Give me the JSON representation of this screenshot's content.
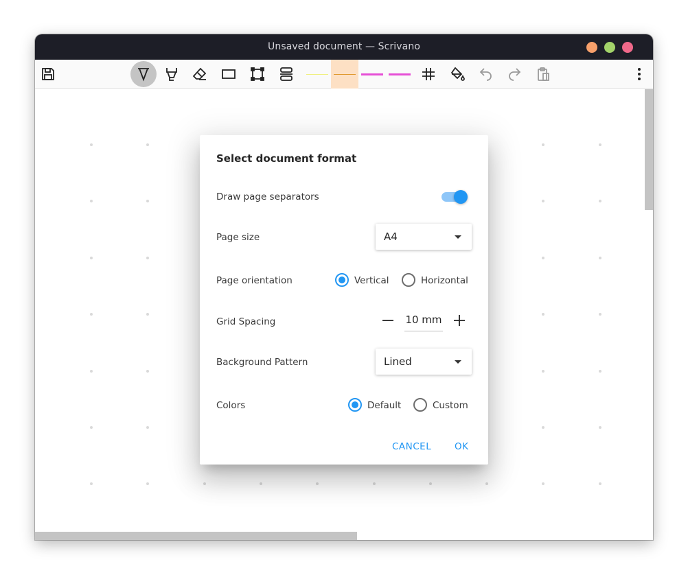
{
  "window": {
    "title": "Unsaved document — Scrivano",
    "controls": [
      {
        "name": "minimize",
        "color": "#f7a06b"
      },
      {
        "name": "maximize",
        "color": "#a3d36a"
      },
      {
        "name": "close",
        "color": "#f0698a"
      }
    ]
  },
  "toolbar": {
    "tools": [
      "save-icon",
      "pen-icon",
      "highlighter-icon",
      "eraser-icon",
      "rectangle-icon",
      "selection-icon",
      "stretch-icon"
    ],
    "active_tool": "pen-icon",
    "pen_colors": [
      "#f0f080",
      "#f0a640",
      "#e64ed6",
      "#e64ed6"
    ],
    "selected_pen_color_index": 1,
    "right_tools": [
      "grid-icon",
      "fill-icon",
      "undo-icon",
      "redo-icon",
      "paste-icon",
      "more-icon"
    ]
  },
  "dialog": {
    "title": "Select document format",
    "separators_label": "Draw page separators",
    "separators_on": true,
    "page_size_label": "Page size",
    "page_size_value": "A4",
    "orientation_label": "Page orientation",
    "orientation_vertical": "Vertical",
    "orientation_horizontal": "Horizontal",
    "orientation_selected": "Vertical",
    "grid_label": "Grid Spacing",
    "grid_value": "10 mm",
    "pattern_label": "Background Pattern",
    "pattern_value": "Lined",
    "colors_label": "Colors",
    "colors_default": "Default",
    "colors_custom": "Custom",
    "colors_selected": "Default",
    "cancel": "CANCEL",
    "ok": "OK"
  },
  "colors": {
    "accent": "#2196f3",
    "titlebar": "#1d1e27"
  }
}
